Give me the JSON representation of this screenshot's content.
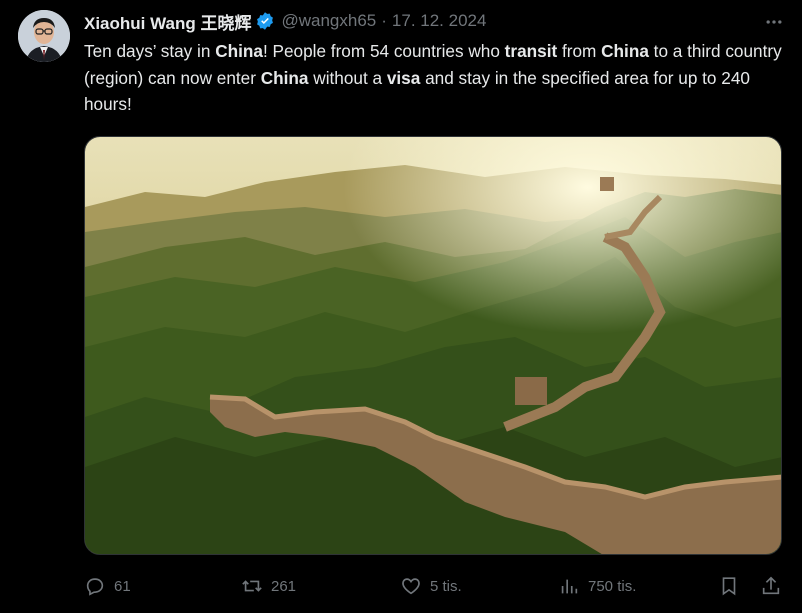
{
  "author": {
    "name": "Xiaohui Wang 王晓辉",
    "handle": "@wangxh65",
    "date": "17. 12. 2024",
    "verified": true
  },
  "tweet": {
    "segments": [
      {
        "text": "Ten days’ stay in ",
        "bold": false
      },
      {
        "text": "China",
        "bold": true
      },
      {
        "text": "! People from 54 countries who ",
        "bold": false
      },
      {
        "text": "transit",
        "bold": true
      },
      {
        "text": " from ",
        "bold": false
      },
      {
        "text": "China",
        "bold": true
      },
      {
        "text": " to a third country (region) can now enter ",
        "bold": false
      },
      {
        "text": "China",
        "bold": true
      },
      {
        "text": " without a ",
        "bold": false
      },
      {
        "text": "visa",
        "bold": true
      },
      {
        "text": " and stay in the specified area for up to 240 hours!",
        "bold": false
      }
    ]
  },
  "media": {
    "icon": "great-wall-photo"
  },
  "actions": {
    "replies": "61",
    "reposts": "261",
    "likes": "5 tis.",
    "views": "750 tis."
  },
  "colors": {
    "background": "#000000",
    "text": "#e7e9ea",
    "secondary": "#71767b",
    "verified": "#1d9bf0"
  }
}
